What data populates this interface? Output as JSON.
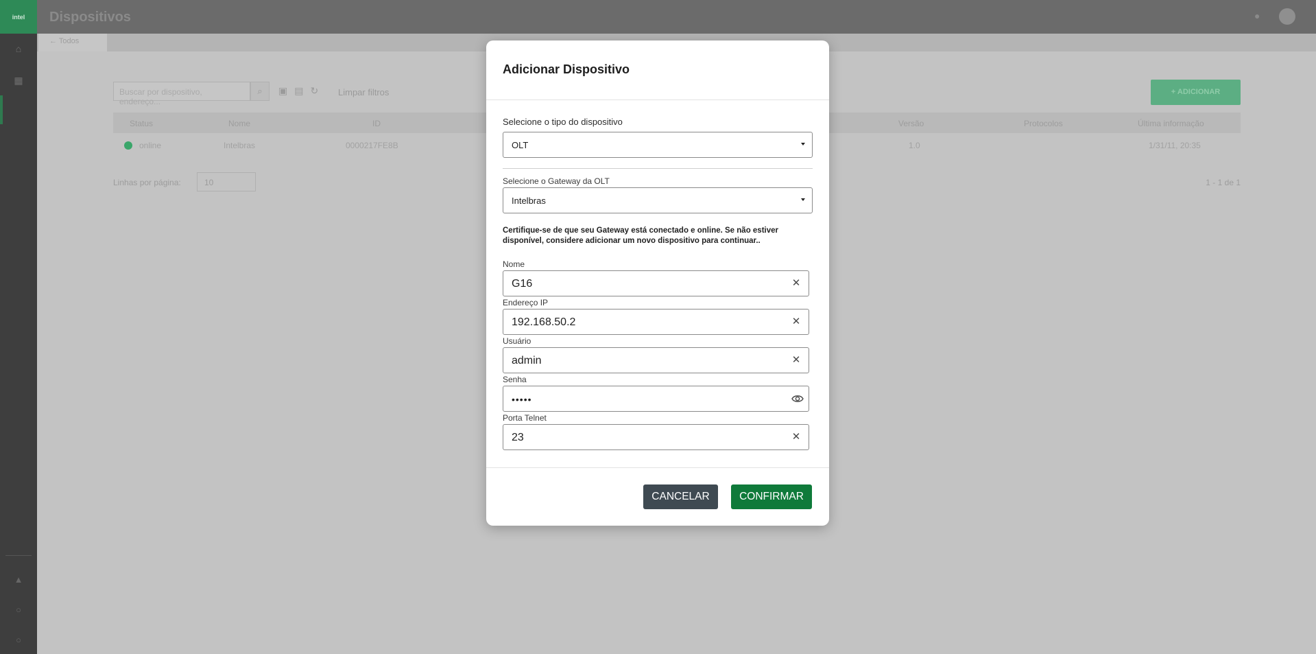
{
  "app": {
    "logo_text": "intel",
    "title": "Dispositivos",
    "tab_label": "Todos"
  },
  "toolbar": {
    "search_placeholder": "Buscar por dispositivo, endereço...",
    "clear_filters": "Limpar filtros",
    "add_button": "+ ADICIONAR"
  },
  "table": {
    "headers": [
      "Status",
      "Nome",
      "ID",
      "Versão",
      "Protocolos",
      "Última informação"
    ],
    "row": {
      "status": "online",
      "name": "Intelbras",
      "id": "0000217FE8B",
      "version": "1.0",
      "protocols": "",
      "last_info": "1/31/11, 20:35"
    },
    "rows_per_page_label": "Linhas por página:",
    "rows_per_page_value": "10",
    "pagination": "1 - 1 de 1"
  },
  "modal": {
    "title": "Adicionar Dispositivo",
    "device_type_label": "Selecione o tipo do dispositivo",
    "device_type_value": "OLT",
    "gateway_label": "Selecione o Gateway da OLT",
    "gateway_value": "Intelbras",
    "notice": "Certifique-se de que seu Gateway está conectado e online. Se não estiver disponível, considere adicionar um novo dispositivo para continuar..",
    "fields": {
      "name": {
        "label": "Nome",
        "value": "G16"
      },
      "ip": {
        "label": "Endereço IP",
        "value": "192.168.50.2"
      },
      "user": {
        "label": "Usuário",
        "value": "admin"
      },
      "password": {
        "label": "Senha",
        "value": "•••••"
      },
      "telnet_port": {
        "label": "Porta Telnet",
        "value": "23"
      }
    },
    "cancel_label": "CANCELAR",
    "confirm_label": "CONFIRMAR"
  },
  "icons": {
    "clear": "close-icon",
    "show_password": "eye-icon",
    "dropdown": "caret-down-icon",
    "search": "search-icon"
  },
  "colors": {
    "confirm": "#0f7a3a",
    "cancel": "#3f4a52",
    "online": "#3aa66a"
  }
}
